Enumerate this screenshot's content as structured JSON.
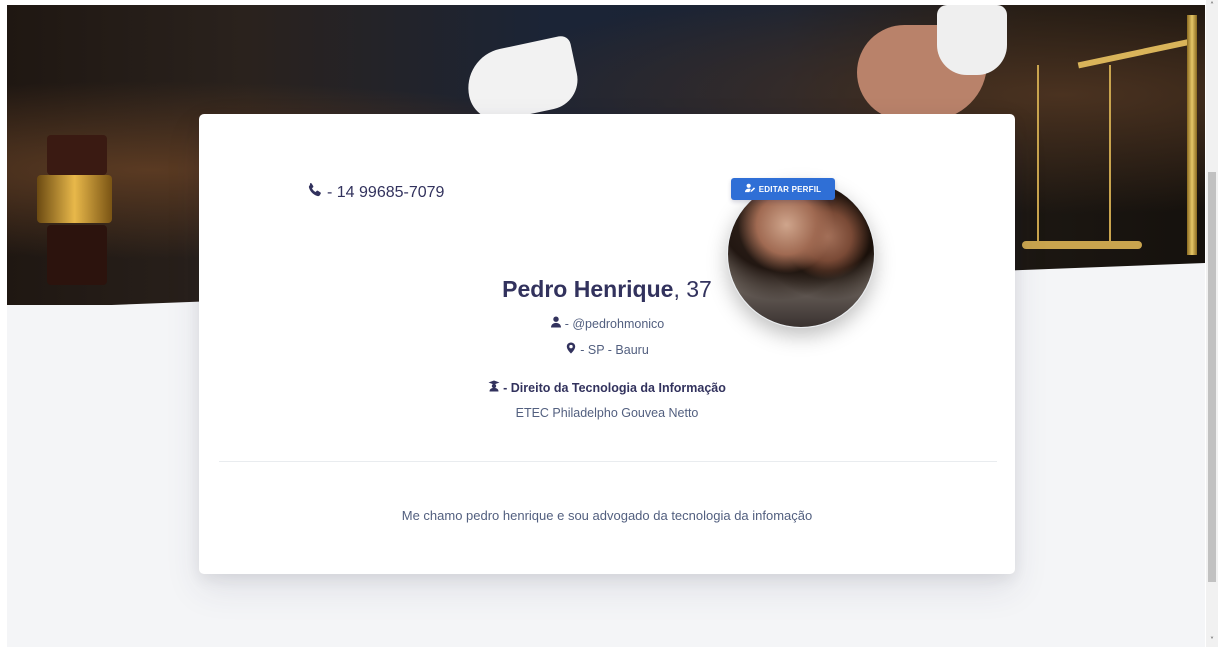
{
  "profile": {
    "phone": "- 14 99685-7079",
    "edit_button": "EDITAR PERFIL",
    "name": "Pedro Henrique",
    "age": ", 37",
    "handle": "- @pedrohmonico",
    "location": "- SP - Bauru",
    "course": "- Direito da Tecnologia da Informação",
    "school": "ETEC Philadelpho Gouvea Netto",
    "bio": "Me chamo pedro henrique e sou advogado da tecnologia da infomação"
  },
  "icons": {
    "phone": "phone-icon",
    "edit": "user-edit-icon",
    "user": "user-icon",
    "location": "map-marker-icon",
    "course": "graduate-icon"
  },
  "colors": {
    "primary_button": "#2f6fd6",
    "text_dark": "#32325d",
    "text_muted": "#525f7f",
    "page_bg": "#f4f5f7"
  },
  "scrollbar": {
    "up_arrow": "˄",
    "down_arrow": "˅"
  }
}
